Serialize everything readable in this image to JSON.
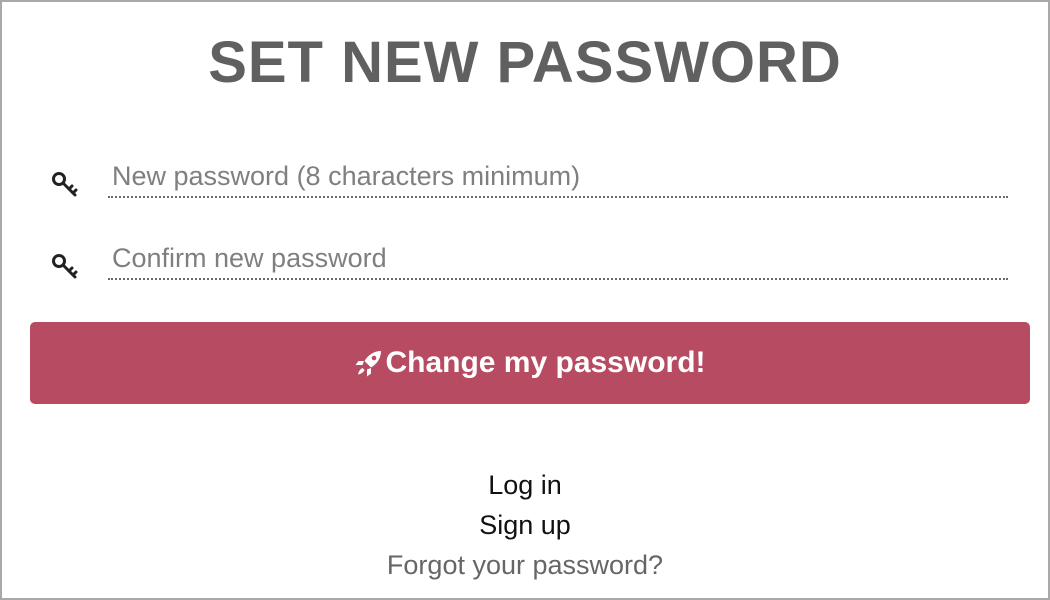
{
  "page": {
    "title": "SET NEW PASSWORD"
  },
  "form": {
    "new_password": {
      "placeholder": "New password (8 characters minimum)",
      "value": "",
      "icon": "key-icon"
    },
    "confirm_password": {
      "placeholder": "Confirm new password",
      "value": "",
      "icon": "key-icon"
    },
    "submit": {
      "label": "Change my password!",
      "icon": "rocket-icon",
      "color": "#b74b61"
    }
  },
  "links": {
    "login": "Log in",
    "signup": "Sign up",
    "forgot": "Forgot your password?"
  }
}
